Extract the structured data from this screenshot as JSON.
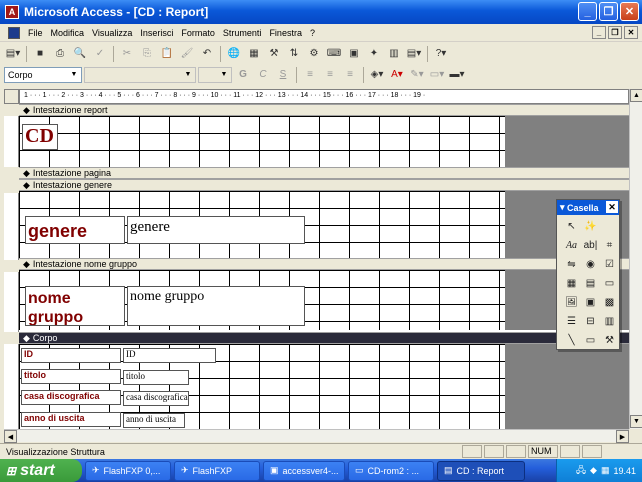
{
  "window": {
    "title": "Microsoft Access - [CD : Report]",
    "app_icon": "access-icon"
  },
  "menu": {
    "items": [
      "File",
      "Modifica",
      "Visualizza",
      "Inserisci",
      "Formato",
      "Strumenti",
      "Finestra",
      "?"
    ]
  },
  "toolbar2": {
    "object_combo": "Corpo",
    "font_combo": "",
    "size_combo": "",
    "bold": "G",
    "italic": "C",
    "underline": "S"
  },
  "ruler": {
    "ticks": "1 · · · 1 · · · 2 · · · 3 · · · 4 · · · 5 · · · 6 · · · 7 · · · 8 · · · 9 · · · 10 · · · 11 · · · 12 · · · 13 · · · 14 · · · 15 · · · 16 · · · 17 · · · 18 · · · 19 ·"
  },
  "sections": {
    "report_header": "Intestazione report",
    "page_header": "Intestazione pagina",
    "group_header_genre": "Intestazione genere",
    "group_header_name": "Intestazione nome gruppo",
    "detail": "Corpo"
  },
  "controls": {
    "report_title": "CD",
    "genere_label": "genere",
    "genere_field": "genere",
    "nome_label": "nome gruppo",
    "nome_field": "nome gruppo",
    "id_label": "ID",
    "id_field": "ID",
    "titolo_label": "titolo",
    "titolo_field": "titolo",
    "casa_label": "casa discografica",
    "casa_field": "casa discografica",
    "anno_label": "anno di uscita",
    "anno_field": "anno di uscita"
  },
  "toolbox": {
    "title": "Casella",
    "tool_names": [
      "select-objects-icon",
      "wizard-icon",
      "label-icon",
      "textbox-icon",
      "option-group-icon",
      "toggle-button-icon",
      "option-button-icon",
      "checkbox-icon",
      "combo-box-icon",
      "list-box-icon",
      "command-button-icon",
      "image-icon",
      "unbound-frame-icon",
      "bound-frame-icon",
      "page-break-icon",
      "tab-control-icon",
      "subform-icon",
      "line-icon",
      "rectangle-icon",
      "more-controls-icon"
    ]
  },
  "status": {
    "text": "Visualizzazione Struttura",
    "num": "NUM"
  },
  "taskbar": {
    "start": "start",
    "tasks": [
      "FlashFXP 0,...",
      "FlashFXP",
      "accessver4-...",
      "CD-rom2 : ...",
      "CD : Report"
    ],
    "clock": "19.41"
  },
  "colors": {
    "label_red": "#800000",
    "titlebar_blue": "#0a58d8",
    "detail_header": "#2a2a3a"
  }
}
